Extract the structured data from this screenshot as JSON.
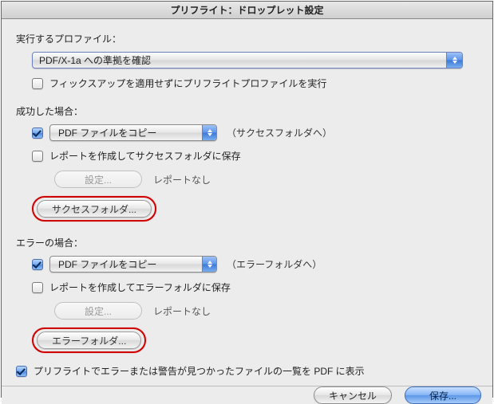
{
  "window": {
    "title": "プリフライト：ドロップレット設定"
  },
  "profile": {
    "label": "実行するプロファイル：",
    "selected": "PDF/X-1a への準拠を確認",
    "fixups_checkbox": "フィックスアップを適用せずにプリフライトプロファイルを実行"
  },
  "success": {
    "label": "成功した場合：",
    "copy_pdf": "PDF ファイルをコピー",
    "destination_hint": "（サクセスフォルダへ）",
    "create_report": "レポートを作成してサクセスフォルダに保存",
    "settings_btn": "設定...",
    "report_none": "レポートなし",
    "folder_btn": "サクセスフォルダ..."
  },
  "error": {
    "label": "エラーの場合：",
    "copy_pdf": "PDF ファイルをコピー",
    "destination_hint": "（エラーフォルダへ）",
    "create_report": "レポートを作成してエラーフォルダに保存",
    "settings_btn": "設定...",
    "report_none": "レポートなし",
    "folder_btn": "エラーフォルダ..."
  },
  "summary_pdf_checkbox": "プリフライトでエラーまたは警告が見つかったファイルの一覧を PDF に表示",
  "footer": {
    "cancel": "キャンセル",
    "save": "保存..."
  }
}
